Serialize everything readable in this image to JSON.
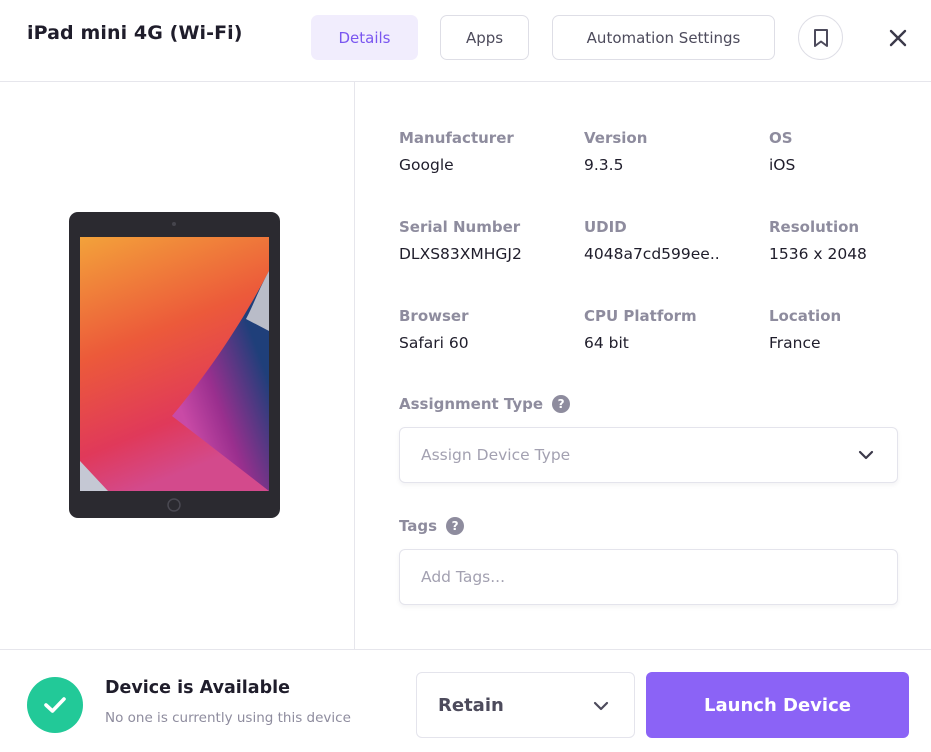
{
  "header": {
    "title": "iPad mini 4G (Wi-Fi)",
    "tabs": [
      {
        "label": "Details",
        "active": true
      },
      {
        "label": "Apps",
        "active": false
      },
      {
        "label": "Automation Settings",
        "active": false
      }
    ],
    "bookmark_icon": "bookmark-icon",
    "close_icon": "close-icon"
  },
  "device": {
    "image_icon": "tablet-image"
  },
  "specs": [
    {
      "label": "Manufacturer",
      "value": "Google"
    },
    {
      "label": "Version",
      "value": "9.3.5"
    },
    {
      "label": "OS",
      "value": "iOS"
    },
    {
      "label": "Serial Number",
      "value": "DLXS83XMHGJ2"
    },
    {
      "label": "UDID",
      "value": "4048a7cd599ee.."
    },
    {
      "label": "Resolution",
      "value": "1536 x 2048"
    },
    {
      "label": "Browser",
      "value": "Safari 60"
    },
    {
      "label": "CPU Platform",
      "value": "64 bit"
    },
    {
      "label": "Location",
      "value": "France"
    }
  ],
  "assignment": {
    "label": "Assignment Type",
    "help": "?",
    "placeholder": "Assign Device Type"
  },
  "tags": {
    "label": "Tags",
    "help": "?",
    "placeholder": "Add Tags..."
  },
  "footer": {
    "status_title": "Device is Available",
    "status_subtitle": "No one is currently using this device",
    "retain_label": "Retain",
    "launch_label": "Launch Device"
  },
  "colors": {
    "accent": "#8b63f6",
    "accent_light": "#f1edfd",
    "success": "#22c998"
  }
}
